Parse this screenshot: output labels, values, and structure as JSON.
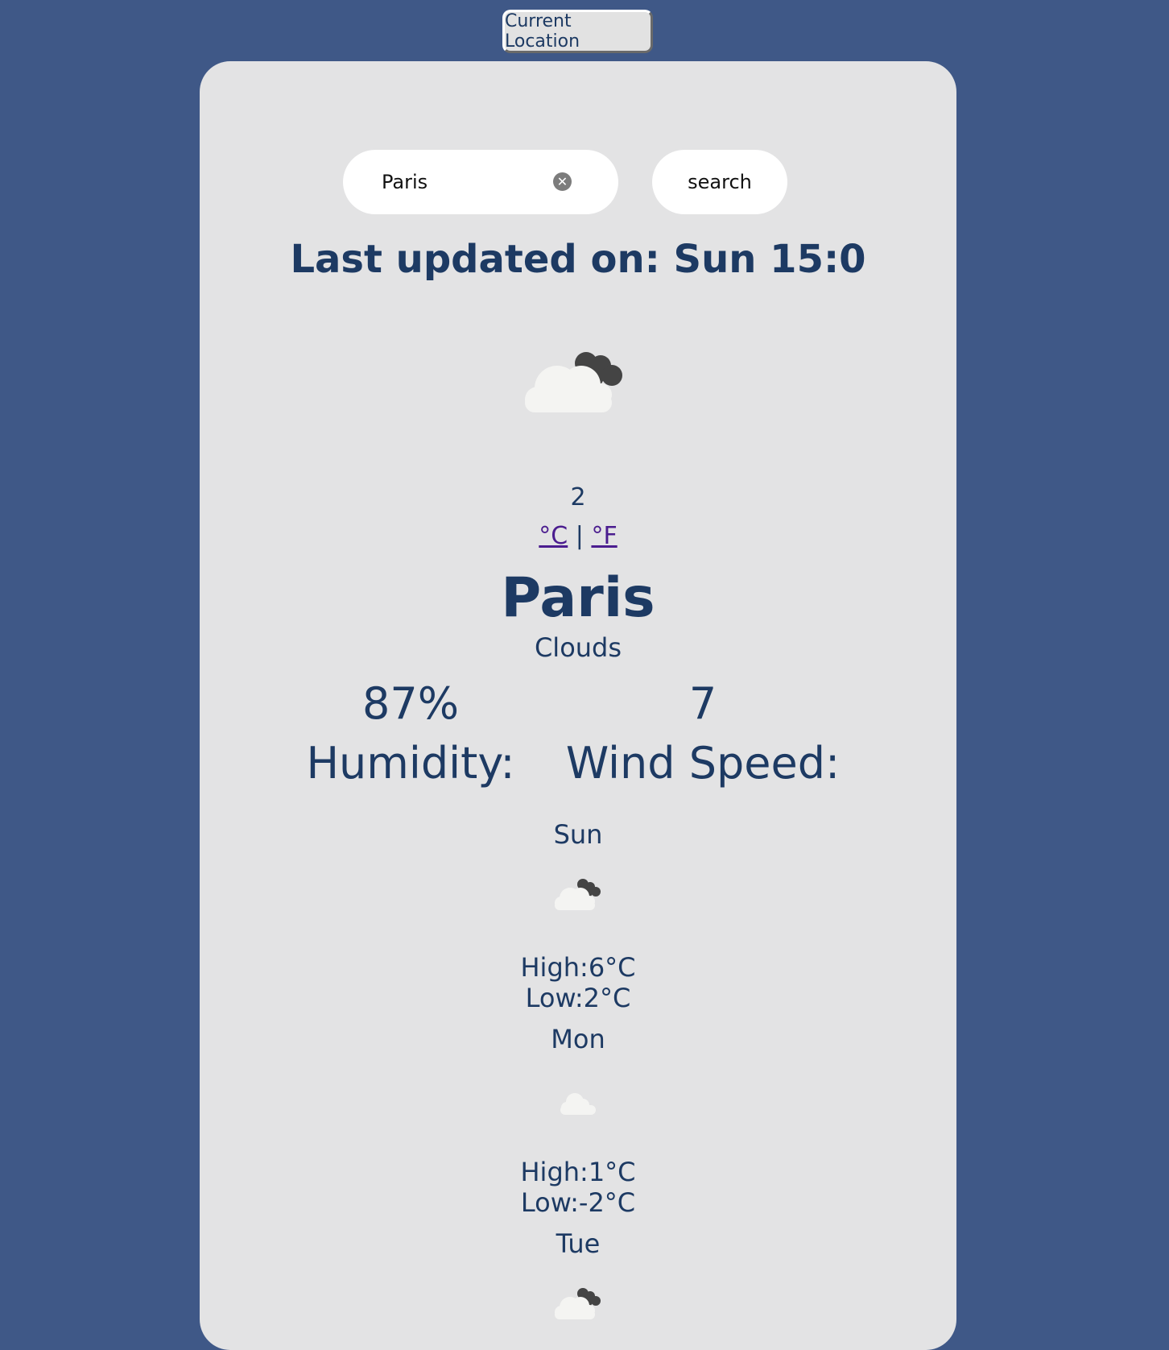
{
  "header": {
    "current_location_label": "Current Location"
  },
  "search": {
    "value": "Paris",
    "clear_icon": "clear-icon",
    "button_label": "search"
  },
  "weather": {
    "last_updated": "Last updated on: Sun 15:0",
    "icon": "cloudy-night-icon",
    "temperature": "2",
    "unit_celsius": "°C",
    "unit_separator": " | ",
    "unit_fahrenheit": "°F",
    "city": "Paris",
    "condition": "Clouds",
    "humidity_value": "87%",
    "humidity_label": "Humidity:",
    "wind_value": "7",
    "wind_label": "Wind Speed:"
  },
  "forecast": [
    {
      "day": "Sun",
      "icon": "cloudy-night-icon",
      "high": "High:6°C",
      "low": "Low:2°C"
    },
    {
      "day": "Mon",
      "icon": "cloud-icon",
      "high": "High:1°C",
      "low": "Low:-2°C"
    },
    {
      "day": "Tue",
      "icon": "cloudy-night-icon"
    }
  ],
  "colors": {
    "background": "#3f5887",
    "card": "#e3e3e4",
    "text": "#1d3a63",
    "link": "#4b1d8f"
  }
}
